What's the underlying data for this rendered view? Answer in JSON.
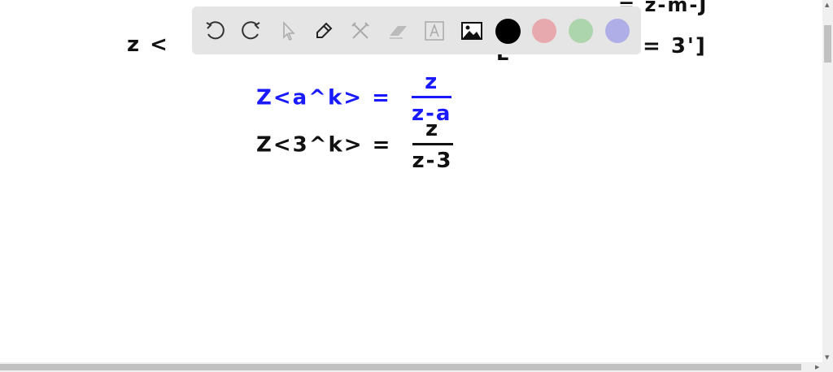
{
  "canvas": {
    "partial_left": "z <",
    "partial_top_right": "= z-m-J",
    "partial_right": "= 3']",
    "partial_bracket": "L",
    "formula_general": {
      "lhs": "Z<a^k> =",
      "numerator": "z",
      "denominator": "z-a",
      "color": "#1a1aff"
    },
    "formula_specific": {
      "lhs": "Z<3^k> =",
      "numerator": "z",
      "denominator": "z-3",
      "color": "#111111"
    }
  },
  "toolbar": {
    "tools": [
      "undo-icon",
      "redo-icon",
      "pointer-icon",
      "pen-icon",
      "tools-icon",
      "eraser-icon",
      "text-icon",
      "image-icon"
    ],
    "colors": [
      "#000000",
      "#e8a9ae",
      "#add5ad",
      "#b0aee6"
    ],
    "selected_color": "#000000"
  }
}
